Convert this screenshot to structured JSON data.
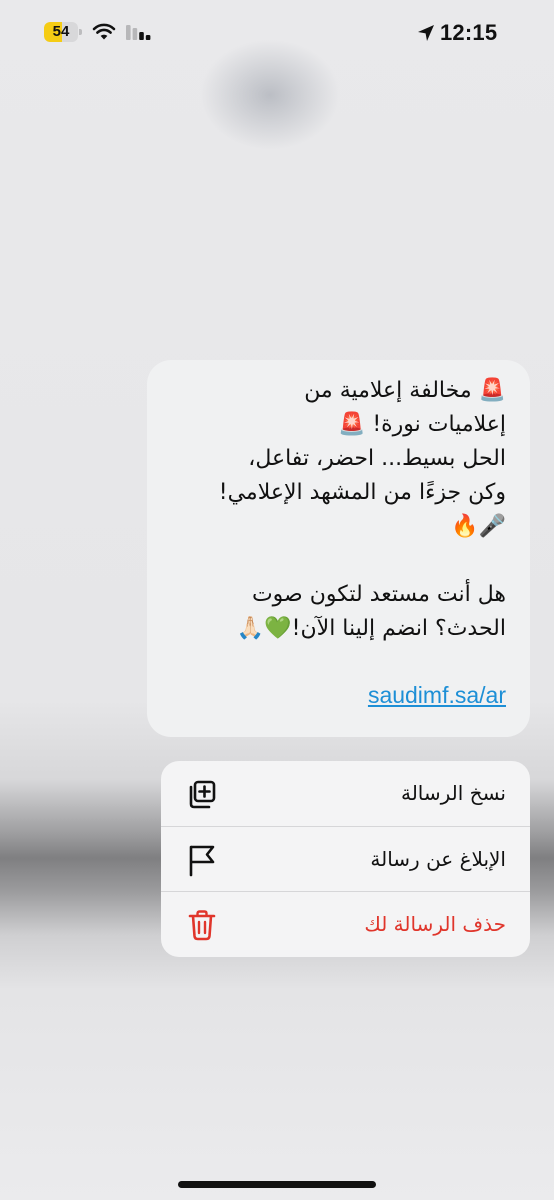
{
  "status_bar": {
    "battery_level": "54",
    "battery_fraction": 0.54,
    "time": "12:15",
    "battery_color": "#f5cc14"
  },
  "message": {
    "lines": [
      "🚨 مخالفة إعلامية من",
      "إعلاميات نورة! 🚨",
      "الحل بسيط... احضر، تفاعل،",
      "وكن جزءًا من المشهد الإعلامي!",
      "🎤🔥",
      "",
      "هل أنت مستعد لتكون صوت",
      "الحدث؟ انضم إلينا الآن!💚🙏🏻"
    ],
    "link": "saudimf.sa/ar",
    "link_color": "#1d8fd6"
  },
  "menu": {
    "items": [
      {
        "label": "نسخ الرسالة",
        "icon": "copy-icon"
      },
      {
        "label": "الإبلاغ عن رسالة",
        "icon": "flag-icon"
      },
      {
        "label": "حذف الرسالة لك",
        "icon": "trash-icon",
        "color": "#e0352b"
      }
    ]
  }
}
